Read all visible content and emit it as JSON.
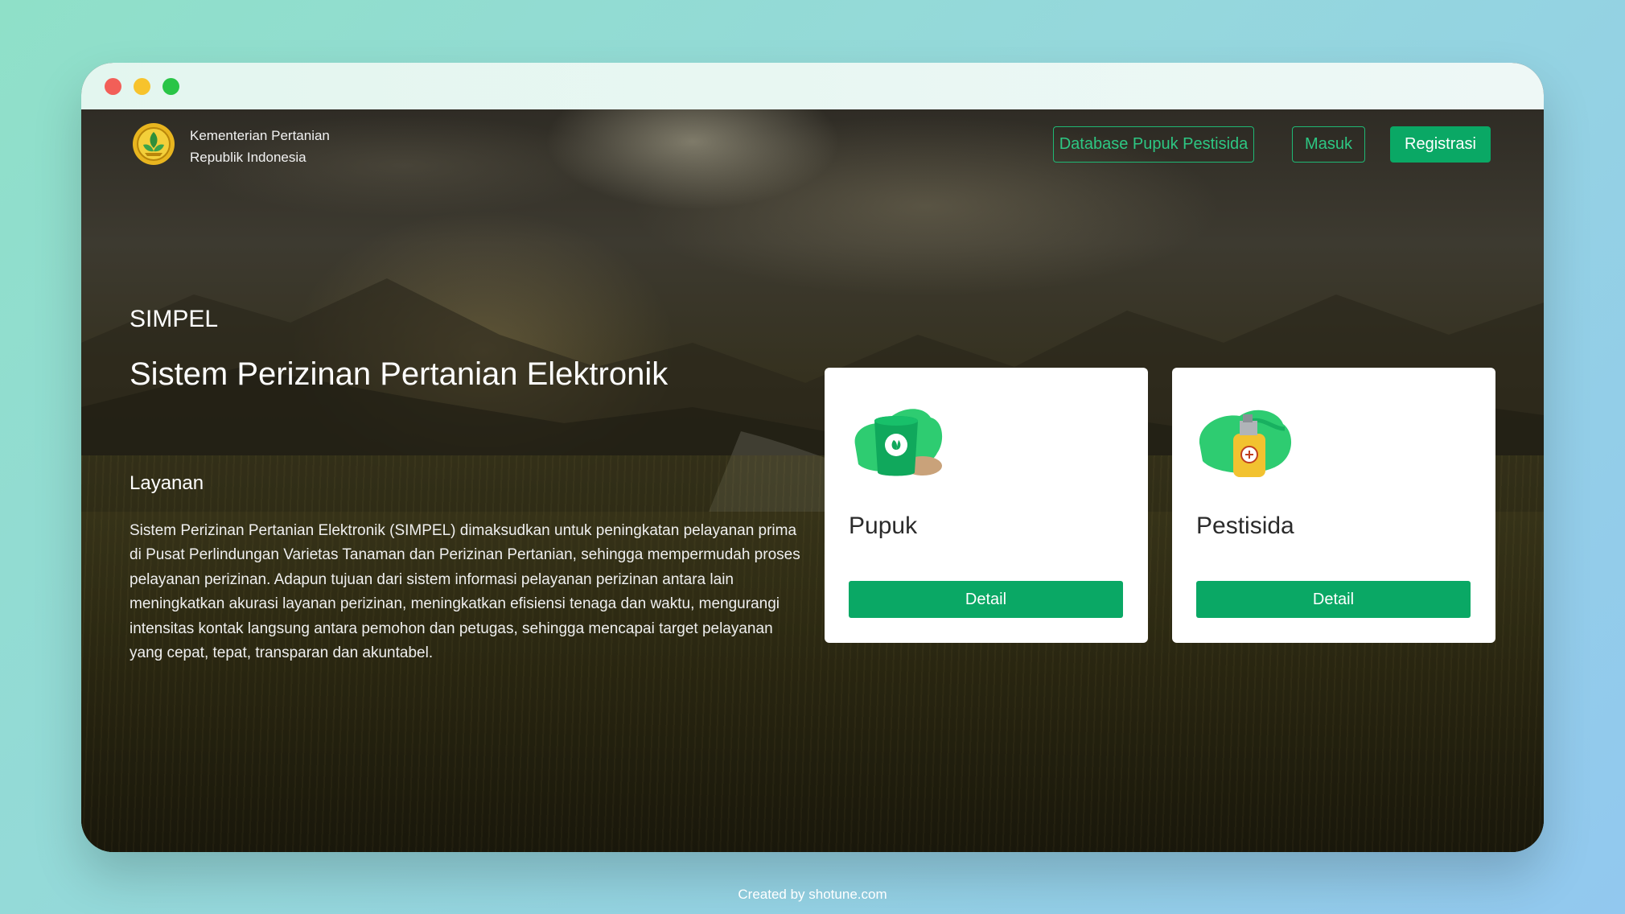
{
  "header": {
    "org_line1": "Kementerian Pertanian",
    "org_line2": "Republik Indonesia",
    "logo_icon": "ministry-emblem-icon"
  },
  "nav": {
    "database_label": "Database Pupuk Pestisida",
    "login_label": "Masuk",
    "register_label": "Registrasi"
  },
  "hero": {
    "brand": "SIMPEL",
    "title": "Sistem Perizinan Pertanian Elektronik",
    "section_heading": "Layanan",
    "description": "Sistem Perizinan Pertanian Elektronik (SIMPEL) dimaksudkan untuk peningkatan pelayanan prima di Pusat Perlindungan Varietas Tanaman dan Perizinan Pertanian, sehingga mempermudah proses pelayanan perizinan. Adapun tujuan dari sistem informasi pelayanan perizinan antara lain meningkatkan akurasi layanan perizinan, meningkatkan efisiensi tenaga dan waktu, mengurangi intensitas kontak langsung antara pemohon dan petugas, sehingga mencapai target pelayanan yang cepat, tepat, transparan dan akuntabel."
  },
  "cards": [
    {
      "title": "Pupuk",
      "button": "Detail",
      "icon": "fertilizer-bag-icon"
    },
    {
      "title": "Pestisida",
      "button": "Detail",
      "icon": "pesticide-spray-icon"
    }
  ],
  "footer": {
    "credit": "Created by shotune.com"
  },
  "colors": {
    "accent": "#0aa865",
    "accent_outline": "#1fb874",
    "card_bg": "#ffffff"
  }
}
